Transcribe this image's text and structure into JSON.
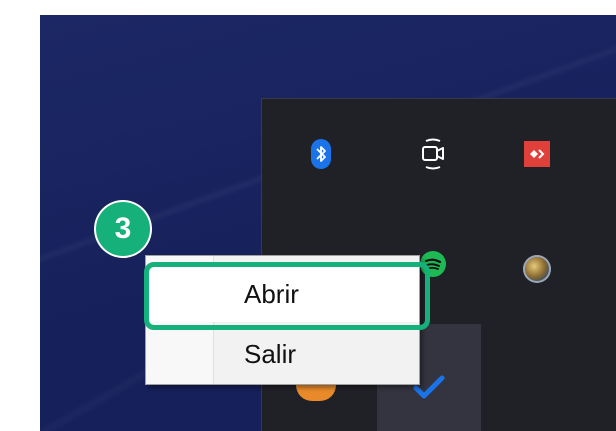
{
  "step": {
    "number": "3"
  },
  "tray_icons": [
    {
      "name": "bluetooth-icon",
      "glyph": "ᛒ",
      "color": "#1a73e8"
    },
    {
      "name": "camera-icon",
      "glyph": "",
      "color": "#ffffff"
    },
    {
      "name": "anydesk-icon",
      "glyph": "◆›",
      "color": "#e0403a"
    },
    {
      "name": "dots-icon",
      "glyph": "..",
      "color": "#ffffff"
    },
    {
      "name": "spotify-icon",
      "glyph": "",
      "color": "#1db954"
    },
    {
      "name": "globe-app-icon",
      "glyph": "",
      "color": "#8a6a30"
    },
    {
      "name": "orange-app-icon",
      "glyph": "",
      "color": "#e88a2a"
    },
    {
      "name": "checkmark-app-icon",
      "glyph": "✔",
      "color": "#1a73e8"
    }
  ],
  "context_menu": {
    "items": [
      {
        "label": "Abrir"
      },
      {
        "label": "Salir"
      }
    ]
  },
  "colors": {
    "accent": "#16b07a",
    "desktop": "#16205a",
    "tray": "#202027"
  }
}
